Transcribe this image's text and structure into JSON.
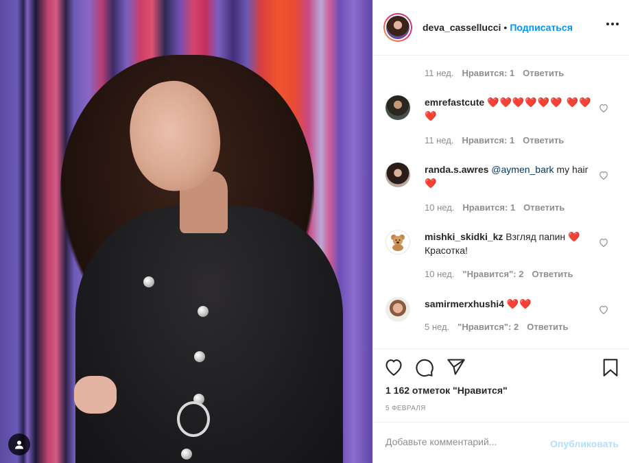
{
  "header": {
    "username": "deva_cassellucci",
    "separator": "•",
    "follow_label": "Подписаться"
  },
  "first_meta": {
    "time": "11 нед.",
    "likes": "Нравится: 1",
    "reply": "Ответить"
  },
  "comments": [
    {
      "username": "emrefastcute",
      "text": "",
      "hearts": "❤️❤️❤️❤️❤️❤️ ❤️❤️❤️",
      "time": "11 нед.",
      "likes": "Нравится: 1",
      "reply": "Ответить"
    },
    {
      "username": "randa.s.awres",
      "mention": "@aymen_bark",
      "text": " my hair",
      "hearts": "❤️",
      "time": "10 нед.",
      "likes": "Нравится: 1",
      "reply": "Ответить"
    },
    {
      "username": "mishki_skidki_kz",
      "text": " Взгляд папин",
      "hearts": "❤️",
      "text2": " Красотка!",
      "time": "10 нед.",
      "likes": "\"Нравится\": 2",
      "reply": "Ответить"
    },
    {
      "username": "samirmerxhushi4",
      "text": "",
      "hearts": "❤️❤️",
      "time": "5 нед.",
      "likes": "\"Нравится\": 2",
      "reply": "Ответить"
    }
  ],
  "post": {
    "likes_text": "1 162 отметок \"Нравится\"",
    "date": "5 ФЕВРАЛЯ"
  },
  "composer": {
    "placeholder": "Добавьте комментарий...",
    "publish_label": "Опубликовать"
  },
  "colors": {
    "accent": "#0095f6",
    "publish_disabled": "#b2dffc",
    "heart_red": "#ed1c3a",
    "meta_gray": "#8e8e8e"
  }
}
